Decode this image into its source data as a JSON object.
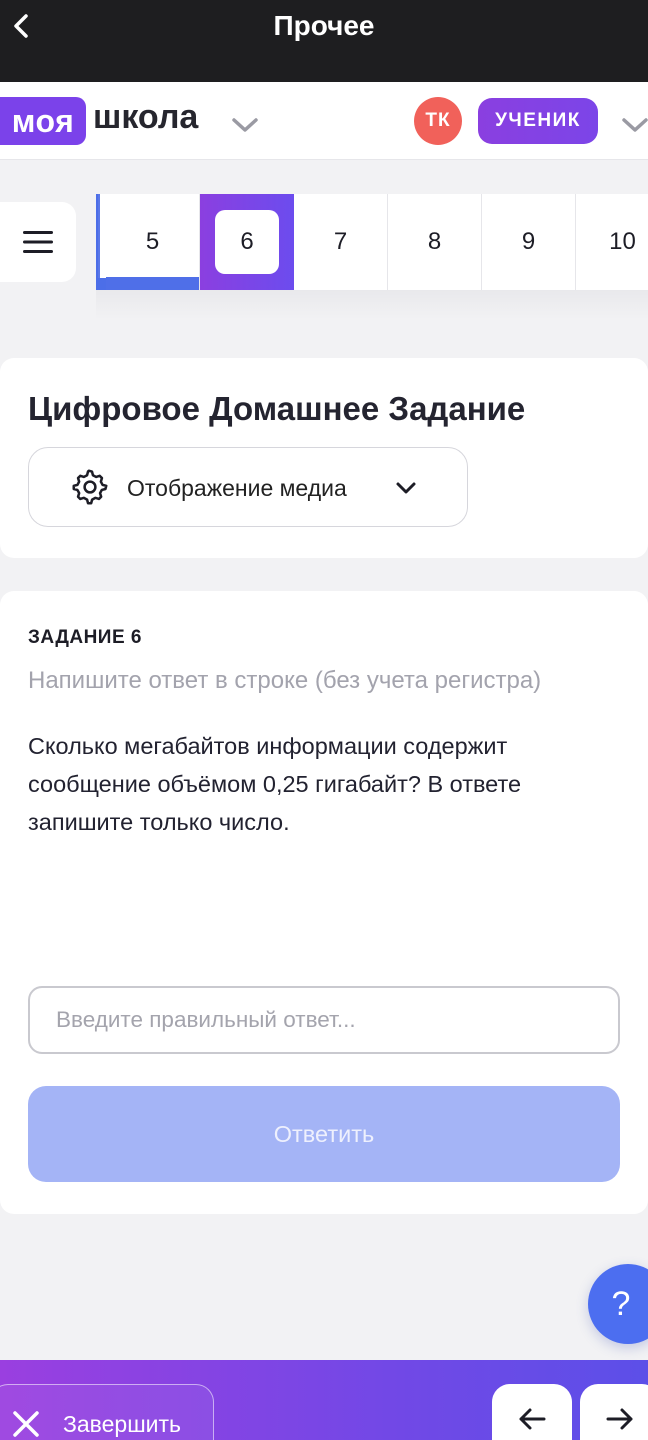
{
  "topbar": {
    "title": "Прочее"
  },
  "header": {
    "logo_part1": "моя",
    "logo_part2": "школа",
    "avatar_initials": "ТК",
    "role": "УЧЕНИК"
  },
  "tasks_nav": {
    "tabs": [
      {
        "label": "5",
        "state": "done"
      },
      {
        "label": "6",
        "state": "active"
      },
      {
        "label": "7",
        "state": "default"
      },
      {
        "label": "8",
        "state": "default"
      },
      {
        "label": "9",
        "state": "default"
      },
      {
        "label": "10",
        "state": "default"
      }
    ]
  },
  "assignment": {
    "title": "Цифровое Домашнее Задание",
    "media_toggle_label": "Отображение медиа"
  },
  "task": {
    "label": "ЗАДАНИЕ 6",
    "hint": "Напишите ответ в строке (без учета регистра)",
    "question": "Сколько мегабайтов информации содержит сообщение объёмом 0,25 гигабайт? В ответе запишите только число.",
    "answer_value": "",
    "answer_placeholder": "Введите правильный ответ...",
    "submit_label": "Ответить"
  },
  "help": {
    "label": "?"
  },
  "bottombar": {
    "finish_label": "Завершить"
  },
  "colors": {
    "accent_purple": "#7b42ea",
    "accent_blue": "#4f6fe8",
    "avatar_red": "#f1615a",
    "submit_disabled": "#a4b4f6"
  }
}
